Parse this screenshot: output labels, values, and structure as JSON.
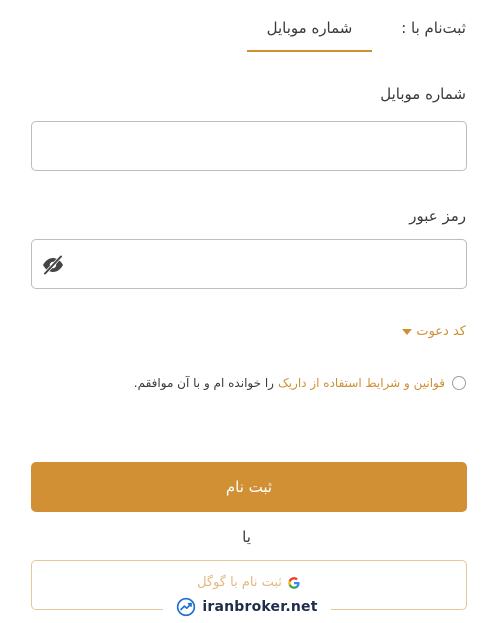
{
  "tabs": {
    "signup_with": "ثبت‌نام با :",
    "mobile_tab": "شماره موبایل"
  },
  "form": {
    "mobile_label": "شماره موبایل",
    "mobile_value": "",
    "password_label": "رمز عبور",
    "password_value": "",
    "invite_code": "کد دعوت",
    "terms_link": "قوانین و شرایط استفاده از داریک",
    "terms_text": "را خوانده ام و با آن موافقم.",
    "submit": "ثبت نام",
    "or": "یا",
    "google_signup": "ثبت نام با گوگل"
  },
  "watermark": {
    "text": "iranbroker.net"
  },
  "colors": {
    "accent": "#d09033",
    "border": "#bdbdbd",
    "text": "#3a3a3a"
  },
  "icons": {
    "password_toggle": "eye-off-icon",
    "invite_toggle": "caret-down-icon",
    "google": "google-icon",
    "watermark": "trend-chart-icon"
  }
}
